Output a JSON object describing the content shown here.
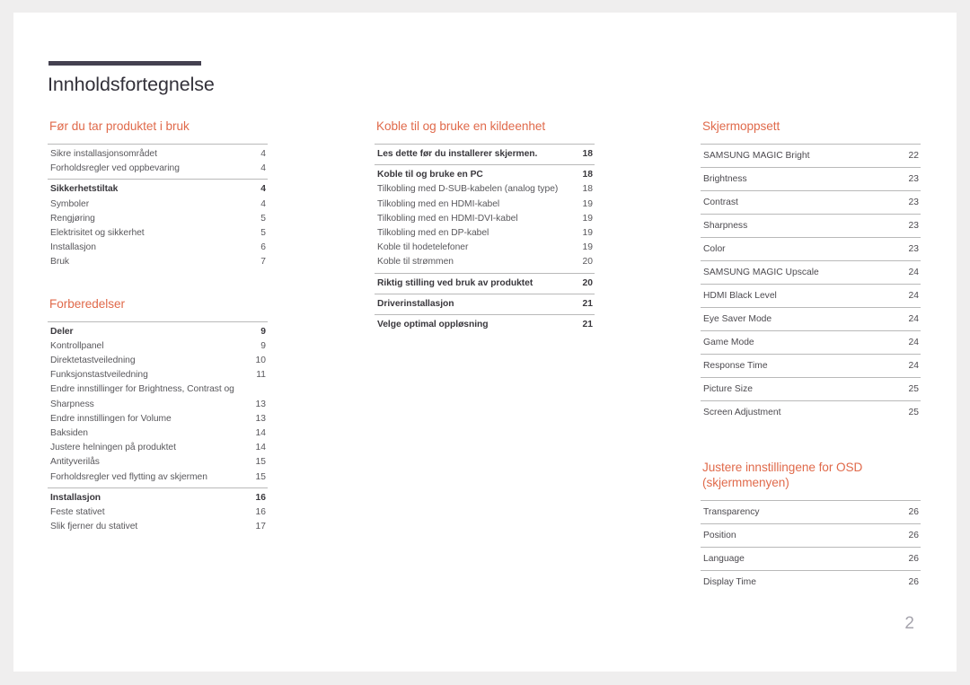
{
  "document": {
    "title": "Innholdsfortegnelse",
    "page_number": "2",
    "accent_color": "#e06a4b",
    "rule_color": "#444150"
  },
  "columns": [
    {
      "sections": [
        {
          "title": "Før du tar produktet i bruk",
          "groups": [
            {
              "entries": [
                {
                  "label": "Sikre installasjonsområdet",
                  "page": "4",
                  "head": false
                },
                {
                  "label": "Forholdsregler ved oppbevaring",
                  "page": "4",
                  "head": false
                }
              ]
            },
            {
              "entries": [
                {
                  "label": "Sikkerhetstiltak",
                  "page": "4",
                  "head": true
                },
                {
                  "label": "Symboler",
                  "page": "4",
                  "head": false
                },
                {
                  "label": "Rengjøring",
                  "page": "5",
                  "head": false
                },
                {
                  "label": "Elektrisitet og sikkerhet",
                  "page": "5",
                  "head": false
                },
                {
                  "label": "Installasjon",
                  "page": "6",
                  "head": false
                },
                {
                  "label": "Bruk",
                  "page": "7",
                  "head": false
                }
              ]
            }
          ]
        },
        {
          "title": "Forberedelser",
          "groups": [
            {
              "entries": [
                {
                  "label": "Deler",
                  "page": "9",
                  "head": true
                },
                {
                  "label": "Kontrollpanel",
                  "page": "9",
                  "head": false
                },
                {
                  "label": "Direktetastveiledning",
                  "page": "10",
                  "head": false
                },
                {
                  "label": "Funksjonstastveiledning",
                  "page": "11",
                  "head": false
                },
                {
                  "label": "Endre innstillinger for Brightness, Contrast og Sharpness",
                  "page": "13",
                  "head": false,
                  "wrap": true
                },
                {
                  "label": "Endre innstillingen for Volume",
                  "page": "13",
                  "head": false
                },
                {
                  "label": "Baksiden",
                  "page": "14",
                  "head": false
                },
                {
                  "label": "Justere helningen på produktet",
                  "page": "14",
                  "head": false
                },
                {
                  "label": "Antityverilås",
                  "page": "15",
                  "head": false
                },
                {
                  "label": "Forholdsregler ved flytting av skjermen",
                  "page": "15",
                  "head": false
                }
              ]
            },
            {
              "entries": [
                {
                  "label": "Installasjon",
                  "page": "16",
                  "head": true
                },
                {
                  "label": "Feste stativet",
                  "page": "16",
                  "head": false
                },
                {
                  "label": "Slik fjerner du stativet",
                  "page": "17",
                  "head": false
                }
              ]
            }
          ]
        }
      ]
    },
    {
      "sections": [
        {
          "title": "Koble til og bruke en kildeenhet",
          "groups": [
            {
              "entries": [
                {
                  "label": "Les dette før du installerer skjermen.",
                  "page": "18",
                  "head": true
                }
              ]
            },
            {
              "entries": [
                {
                  "label": "Koble til og bruke en PC",
                  "page": "18",
                  "head": true
                },
                {
                  "label": "Tilkobling med D-SUB-kabelen (analog type)",
                  "page": "18",
                  "head": false
                },
                {
                  "label": "Tilkobling med en HDMI-kabel",
                  "page": "19",
                  "head": false
                },
                {
                  "label": "Tilkobling med en HDMI-DVI-kabel",
                  "page": "19",
                  "head": false
                },
                {
                  "label": "Tilkobling med en DP-kabel",
                  "page": "19",
                  "head": false
                },
                {
                  "label": "Koble til hodetelefoner",
                  "page": "19",
                  "head": false
                },
                {
                  "label": "Koble til strømmen",
                  "page": "20",
                  "head": false
                }
              ]
            },
            {
              "entries": [
                {
                  "label": "Riktig stilling ved bruk av produktet",
                  "page": "20",
                  "head": true
                }
              ]
            },
            {
              "entries": [
                {
                  "label": "Driverinstallasjon",
                  "page": "21",
                  "head": true
                }
              ]
            },
            {
              "entries": [
                {
                  "label": "Velge optimal oppløsning",
                  "page": "21",
                  "head": true
                }
              ]
            }
          ]
        }
      ]
    },
    {
      "sections": [
        {
          "title": "Skjermoppsett",
          "ruled": true,
          "rows": [
            {
              "label": "SAMSUNG MAGIC Bright",
              "page": "22"
            },
            {
              "label": "Brightness",
              "page": "23"
            },
            {
              "label": "Contrast",
              "page": "23"
            },
            {
              "label": "Sharpness",
              "page": "23"
            },
            {
              "label": "Color",
              "page": "23"
            },
            {
              "label": "SAMSUNG MAGIC Upscale",
              "page": "24"
            },
            {
              "label": "HDMI Black Level",
              "page": "24"
            },
            {
              "label": "Eye Saver Mode",
              "page": "24"
            },
            {
              "label": "Game Mode",
              "page": "24"
            },
            {
              "label": "Response Time",
              "page": "24"
            },
            {
              "label": "Picture Size",
              "page": "25"
            },
            {
              "label": "Screen Adjustment",
              "page": "25"
            }
          ]
        },
        {
          "title": "Justere innstillingene for OSD (skjermmenyen)",
          "ruled": true,
          "rows": [
            {
              "label": "Transparency",
              "page": "26"
            },
            {
              "label": "Position",
              "page": "26"
            },
            {
              "label": "Language",
              "page": "26"
            },
            {
              "label": "Display Time",
              "page": "26"
            }
          ]
        }
      ]
    }
  ]
}
